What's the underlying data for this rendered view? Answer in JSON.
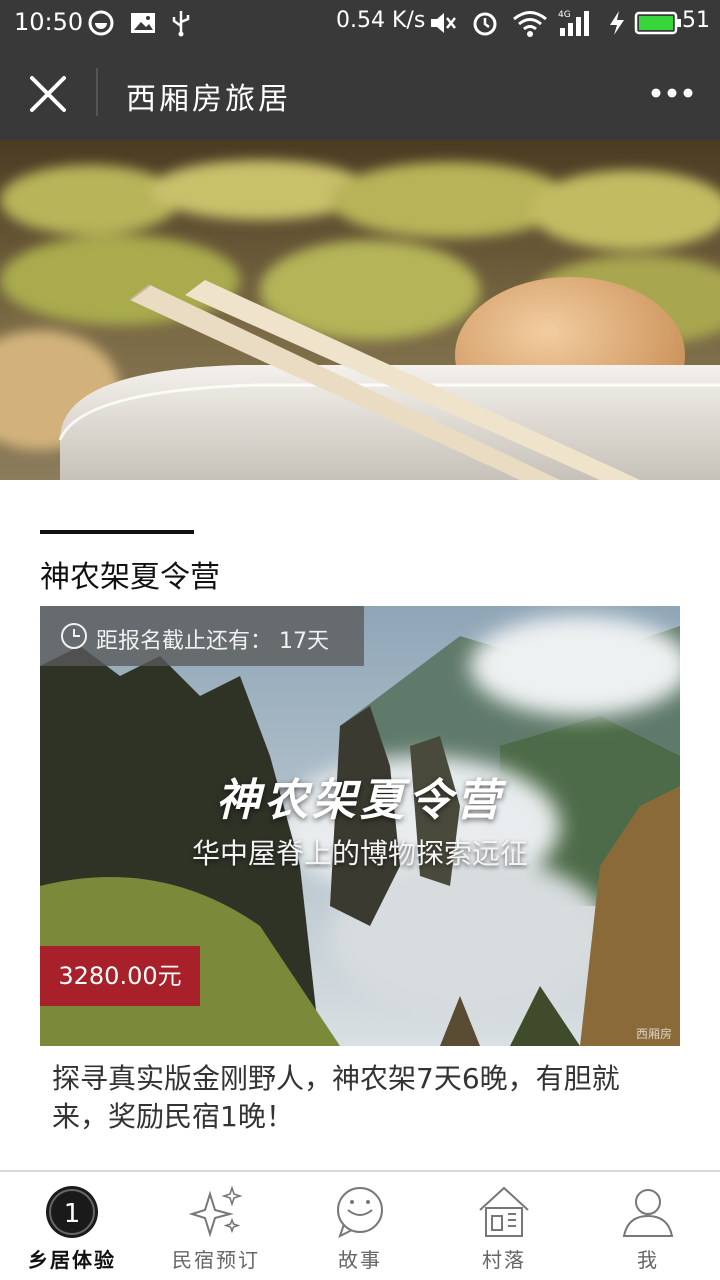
{
  "status_bar": {
    "time": "10:50",
    "speed": "0.54 K/s",
    "battery": "51",
    "network": "4G",
    "icons": [
      "whatsapp-icon",
      "image-icon",
      "usb-icon",
      "mute-icon",
      "alarm-icon",
      "wifi-icon",
      "signal-icon",
      "charging-icon",
      "battery-icon"
    ]
  },
  "nav": {
    "title": "西厢房旅居",
    "close_icon": "close-icon",
    "more_icon": "more-icon"
  },
  "banner": {
    "slides": 3,
    "active_slide": 1
  },
  "section": {
    "title": "神农架夏令营"
  },
  "card": {
    "deadline_text": "距报名截止还有：  17天",
    "headline": "神农架夏令营",
    "subtitle": "华中屋脊上的博物探索远征",
    "price": "3280.00元",
    "description": "探寻真实版金刚野人，神农架7天6晚，有胆就来，奖励民宿1晚！",
    "watermark": "西厢房"
  },
  "tabs": [
    {
      "label": "乡居体验",
      "icon": "badge-1-icon",
      "active": true
    },
    {
      "label": "民宿预订",
      "icon": "sparkle-icon",
      "active": false
    },
    {
      "label": "故事",
      "icon": "chat-bubble-icon",
      "active": false
    },
    {
      "label": "村落",
      "icon": "village-icon",
      "active": false
    },
    {
      "label": "我",
      "icon": "person-icon",
      "active": false
    }
  ],
  "colors": {
    "bar_bg": "#393939",
    "price_bg": "#a8202a",
    "text_dark": "#111111"
  }
}
